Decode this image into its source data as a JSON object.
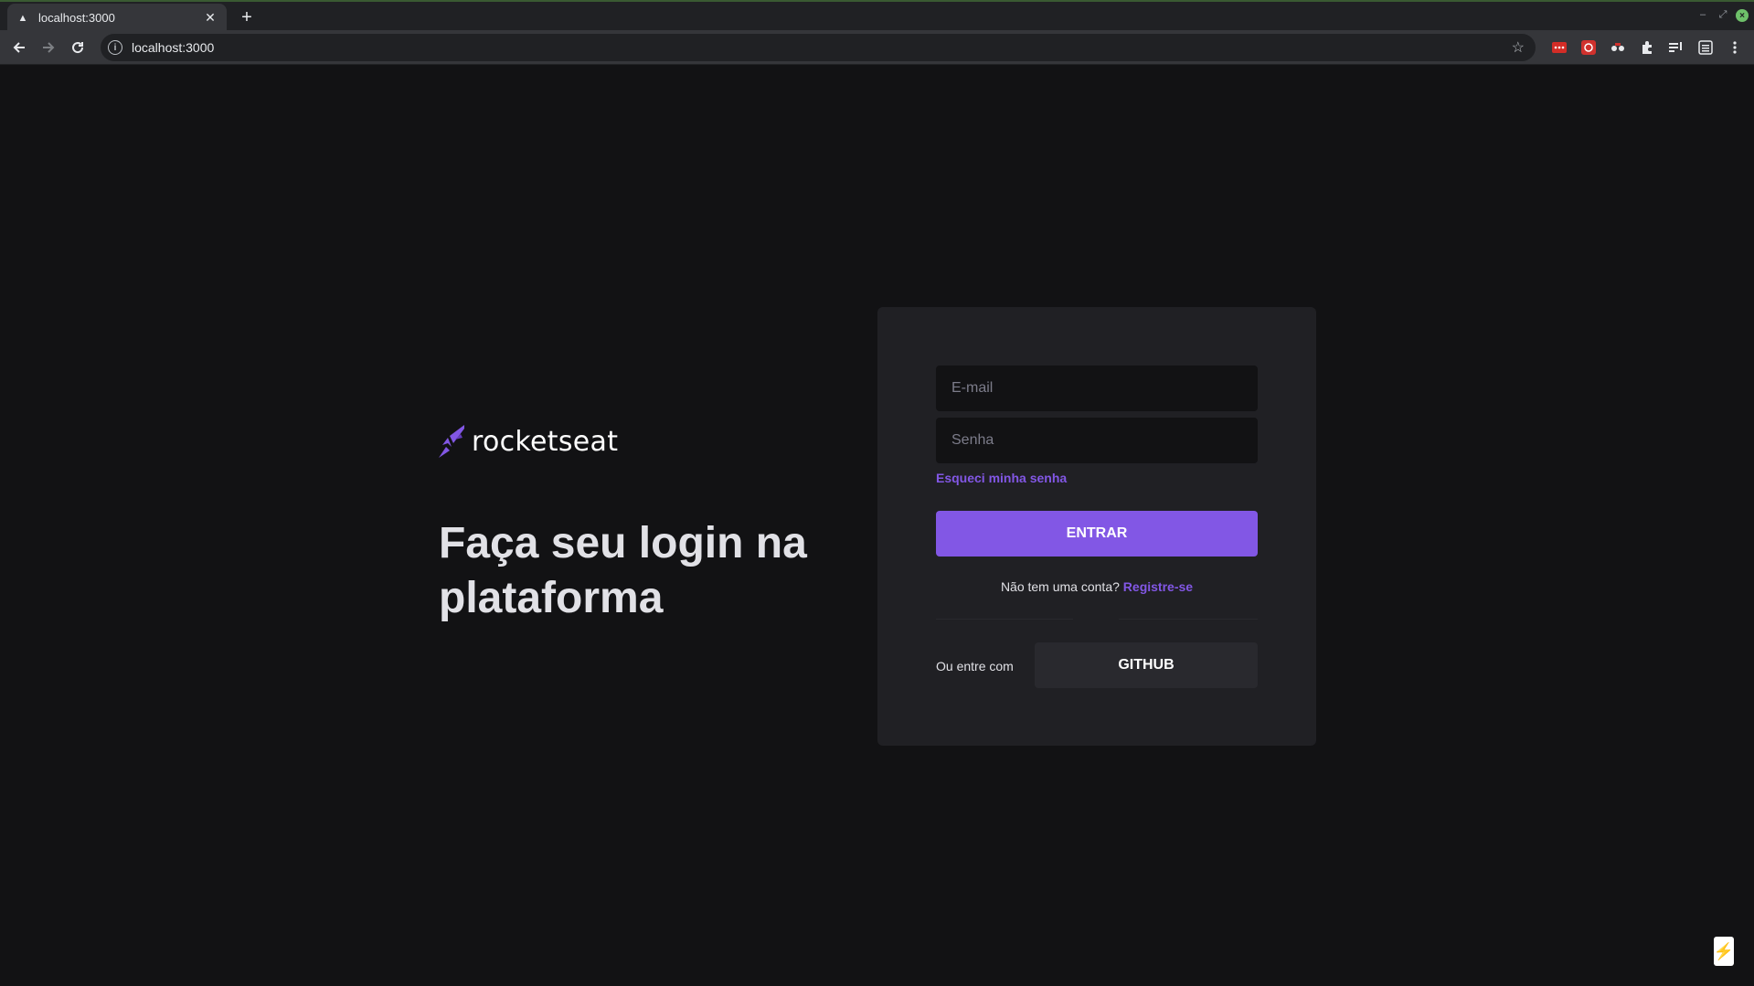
{
  "browser": {
    "tab_title": "localhost:3000",
    "tab_close": "✕",
    "new_tab": "+",
    "url": "localhost:3000"
  },
  "brand": {
    "wordmark": "rocketseat"
  },
  "headline": "Faça seu login na plataforma",
  "form": {
    "email_placeholder": "E-mail",
    "password_placeholder": "Senha",
    "forgot_label": "Esqueci minha senha",
    "submit_label": "ENTRAR",
    "register_prompt": "Não tem uma conta?",
    "register_link": "Registre-se",
    "or_label": "Ou entre com",
    "github_label": "GITHUB"
  },
  "colors": {
    "accent": "#8257e5",
    "background": "#121214",
    "card": "#202024"
  }
}
